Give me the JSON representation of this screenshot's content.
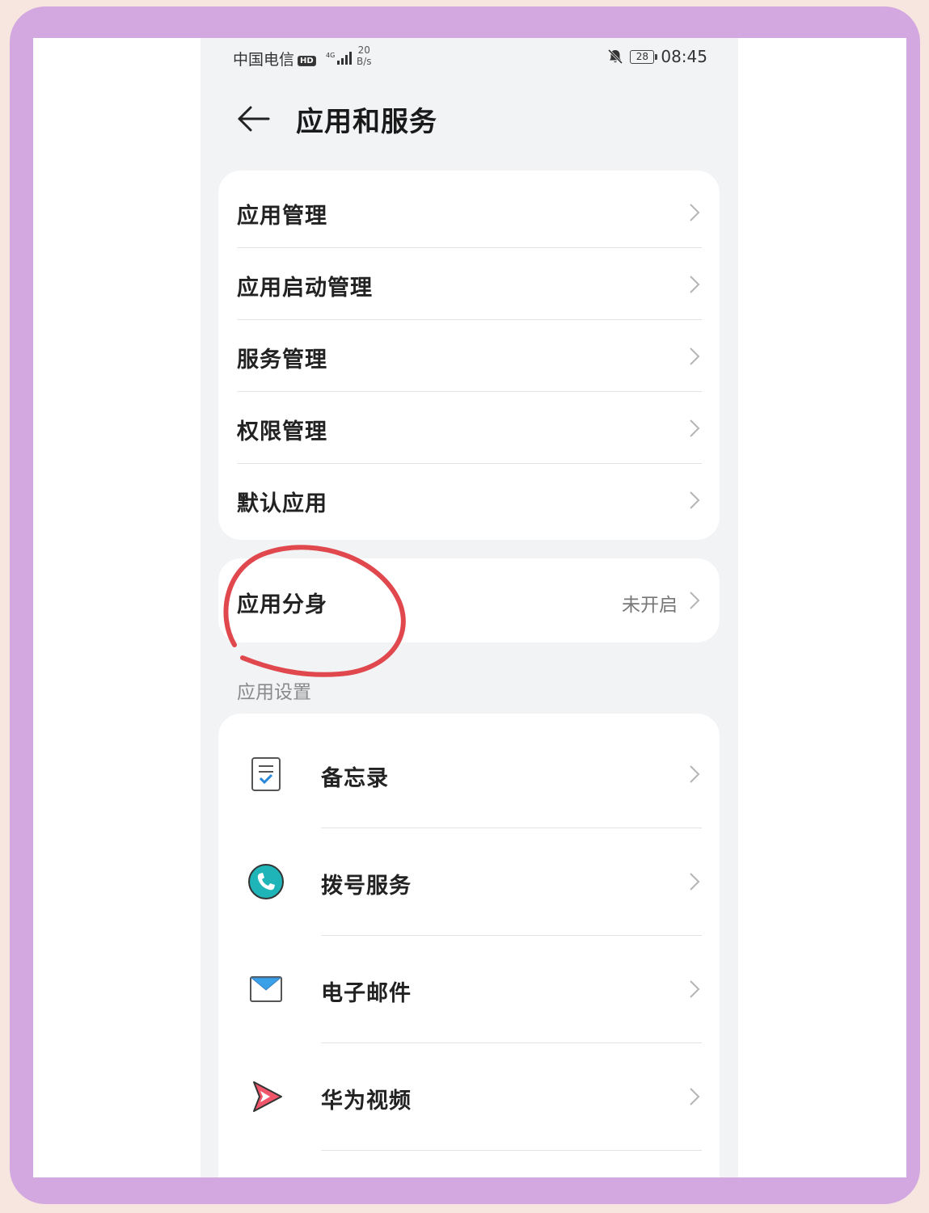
{
  "status_bar": {
    "carrier": "中国电信",
    "hd_badge": "HD",
    "network": "4G",
    "speed_value": "20",
    "speed_unit": "B/s",
    "battery": "28",
    "time": "08:45"
  },
  "header": {
    "title": "应用和服务",
    "back_icon": "arrow-left-icon"
  },
  "menu_group_1": [
    {
      "label": "应用管理"
    },
    {
      "label": "应用启动管理"
    },
    {
      "label": "服务管理"
    },
    {
      "label": "权限管理"
    },
    {
      "label": "默认应用"
    }
  ],
  "app_twin": {
    "label": "应用分身",
    "value": "未开启"
  },
  "section_title": "应用设置",
  "app_settings": [
    {
      "label": "备忘录",
      "icon": "notepad-icon"
    },
    {
      "label": "拨号服务",
      "icon": "phone-icon"
    },
    {
      "label": "电子邮件",
      "icon": "mail-icon"
    },
    {
      "label": "华为视频",
      "icon": "video-play-icon"
    }
  ],
  "colors": {
    "background": "#f1f3f5",
    "frame": "#d3a8e0",
    "annotation_circle": "#e0484e",
    "phone_icon": "#1fb5b8",
    "mail_icon": "#3aa0e8",
    "video_icon": "#f0556a"
  }
}
